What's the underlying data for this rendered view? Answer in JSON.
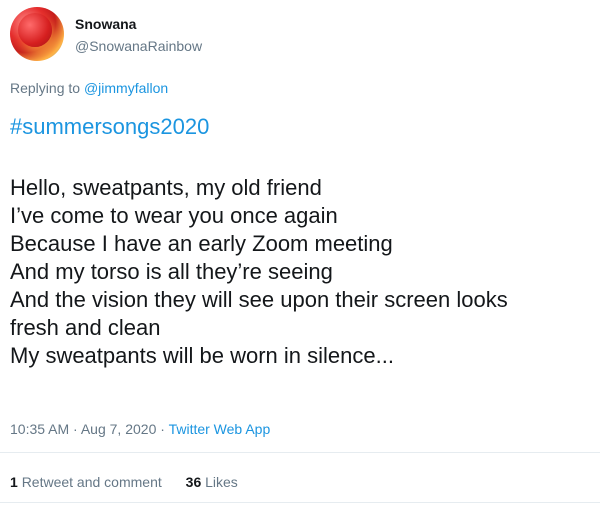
{
  "user": {
    "display_name": "Snowana",
    "handle": "@SnowanaRainbow"
  },
  "reply": {
    "prefix": "Replying to",
    "mention": "@jimmyfallon"
  },
  "tweet": {
    "hashtag": "#summersongs2020",
    "lines": [
      "Hello, sweatpants, my old friend",
      "I’ve come to wear you once again",
      "Because I have an early Zoom meeting",
      "And my torso is all they’re seeing",
      "And the vision they will see upon their screen looks",
      "fresh and clean",
      "My sweatpants will be worn in silence..."
    ],
    "time": "10:35 AM",
    "separator": "·",
    "date": "Aug 7, 2020",
    "source": "Twitter Web App"
  },
  "stats": {
    "retweets_count": "1",
    "retweets_label": "Retweet and comment",
    "likes_count": "36",
    "likes_label": "Likes"
  },
  "colors": {
    "link": "#1b95e0",
    "secondary_text": "#657786",
    "primary_text": "#14171a",
    "divider": "#e6ecf0"
  }
}
